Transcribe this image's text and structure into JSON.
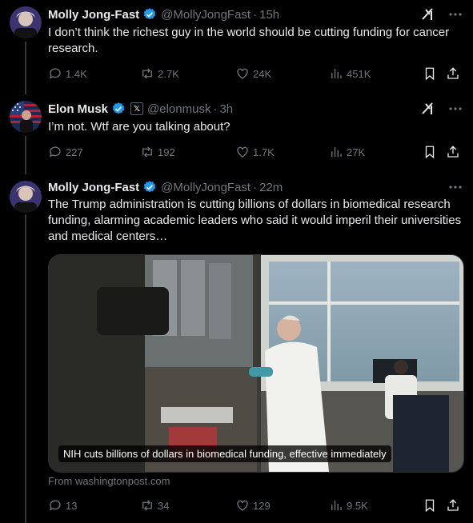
{
  "tweets": [
    {
      "name": "Molly Jong-Fast",
      "handle": "@MollyJongFast",
      "time": "15h",
      "text": "I don’t think the richest guy in the world should be cutting funding for cancer research.",
      "replies": "1.4K",
      "retweets": "2.7K",
      "likes": "24K",
      "views": "451K"
    },
    {
      "name": "Elon Musk",
      "affiliate": "𝕏",
      "handle": "@elonmusk",
      "time": "3h",
      "text": "I’m not. Wtf are you talking about?",
      "replies": "227",
      "retweets": "192",
      "likes": "1.7K",
      "views": "27K"
    },
    {
      "name": "Molly Jong-Fast",
      "handle": "@MollyJongFast",
      "time": "22m",
      "text": "The Trump administration is cutting billions of dollars in biomedical research funding, alarming academic leaders who said it would imperil their universities and medical centers…",
      "card_caption": "NIH cuts billions of dollars in biomedical funding, effective immediately",
      "card_source": "From washingtonpost.com",
      "replies": "13",
      "retweets": "34",
      "likes": "129",
      "views": "9.5K"
    }
  ],
  "separator": "·",
  "colors": {
    "background": "#000000",
    "text": "#e7e9ea",
    "muted": "#71767b",
    "verified": "#1d9bf0",
    "thread_line": "#333639"
  },
  "icons": [
    "verified-badge-icon",
    "grok-icon",
    "more-icon",
    "reply-icon",
    "retweet-icon",
    "like-icon",
    "views-icon",
    "bookmark-icon",
    "share-icon"
  ]
}
